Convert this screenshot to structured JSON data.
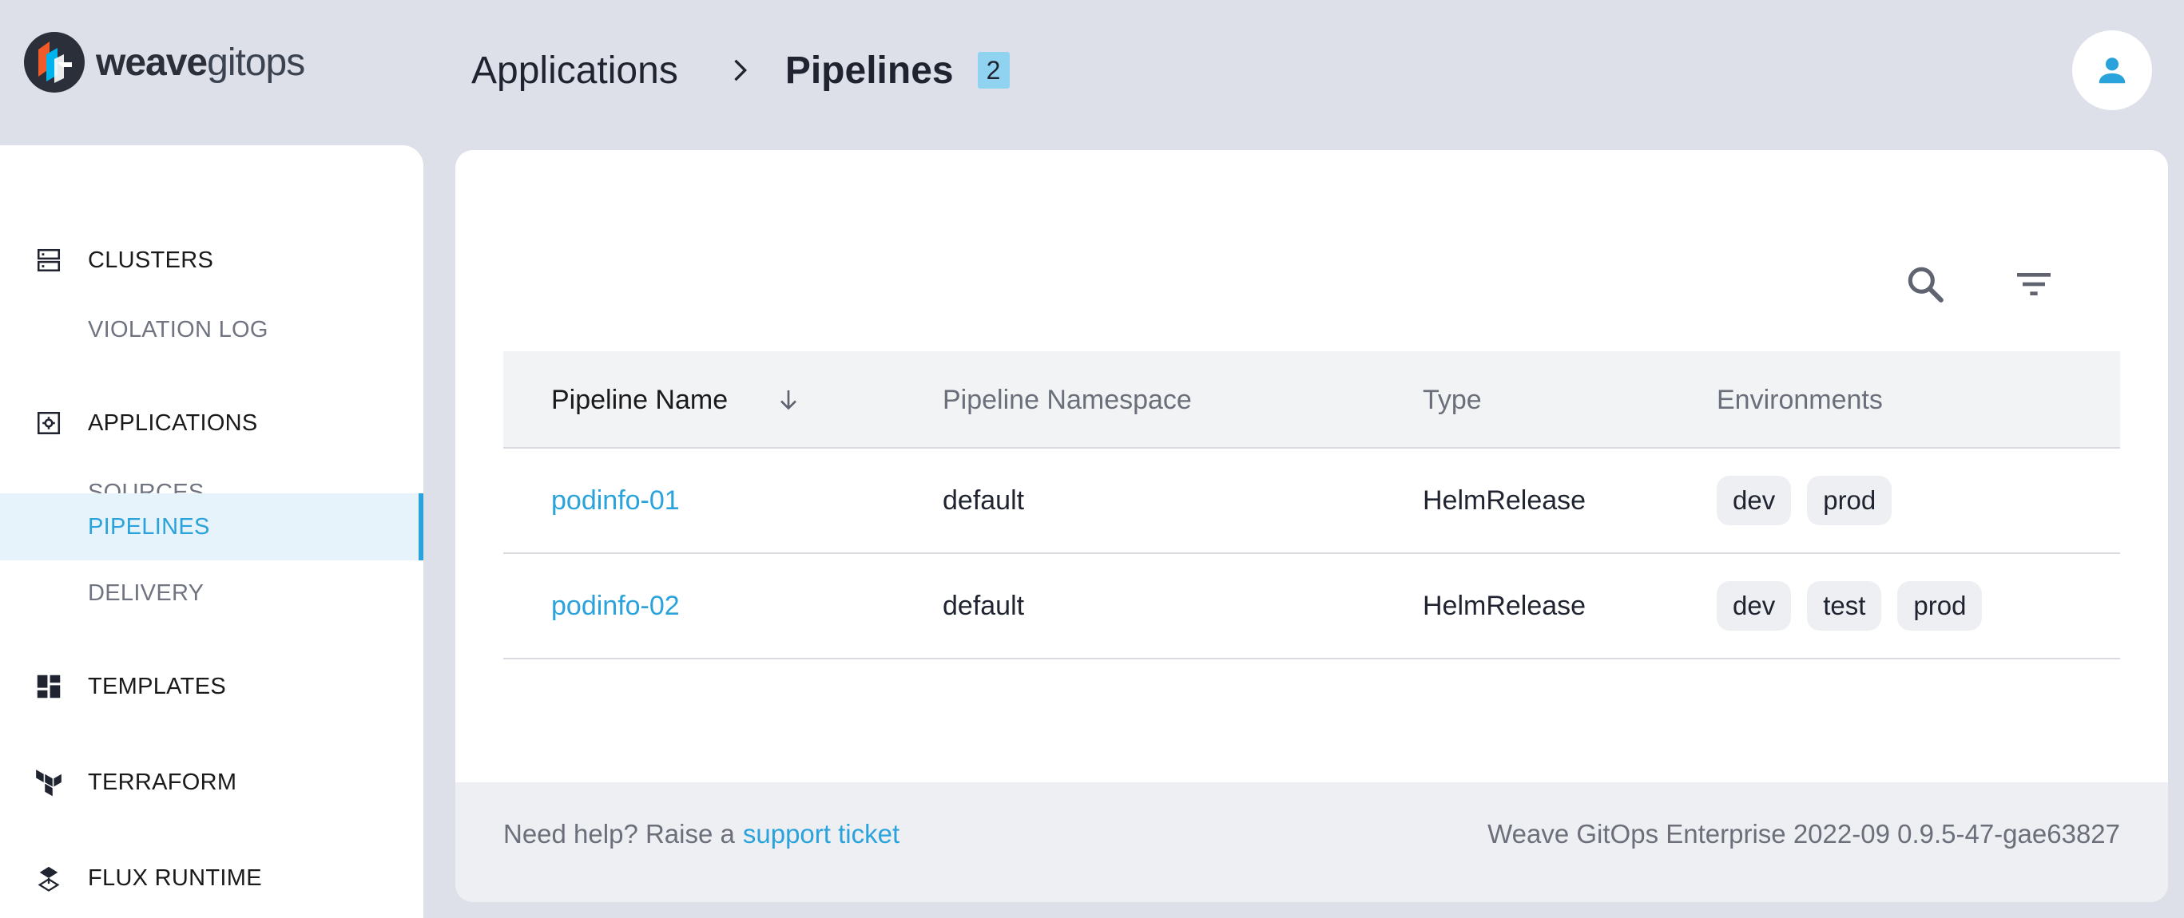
{
  "brand": {
    "name_bold": "weave",
    "name_light": "gitops"
  },
  "breadcrumb": {
    "parent": "Applications",
    "current": "Pipelines",
    "count": "2"
  },
  "sidebar": {
    "items": [
      {
        "label": "CLUSTERS",
        "icon": "server-icon",
        "level": "main"
      },
      {
        "label": "VIOLATION LOG",
        "level": "sub"
      },
      {
        "label": "APPLICATIONS",
        "icon": "app-settings-icon",
        "level": "main"
      },
      {
        "label": "SOURCES",
        "level": "sub"
      },
      {
        "label": "PIPELINES",
        "level": "sub",
        "active": true
      },
      {
        "label": "DELIVERY",
        "level": "sub"
      },
      {
        "label": "TEMPLATES",
        "icon": "dashboard-icon",
        "level": "main"
      },
      {
        "label": "TERRAFORM",
        "icon": "terraform-icon",
        "level": "main"
      },
      {
        "label": "FLUX RUNTIME",
        "icon": "flux-icon",
        "level": "main"
      }
    ]
  },
  "toolbar": {
    "search_icon": "search-icon",
    "filter_icon": "filter-icon"
  },
  "table": {
    "columns": [
      "Pipeline Name",
      "Pipeline Namespace",
      "Type",
      "Environments"
    ],
    "sort_icon": "arrow-down-icon",
    "rows": [
      {
        "name": "podinfo-01",
        "namespace": "default",
        "type": "HelmRelease",
        "environments": [
          "dev",
          "prod"
        ]
      },
      {
        "name": "podinfo-02",
        "namespace": "default",
        "type": "HelmRelease",
        "environments": [
          "dev",
          "test",
          "prod"
        ]
      }
    ]
  },
  "footer": {
    "help_text": "Need help? Raise a",
    "help_link": "support ticket",
    "version": "Weave GitOps Enterprise 2022-09 0.9.5-47-gae63827"
  },
  "colors": {
    "accent": "#2aa3dc",
    "badge": "#8fd3f0",
    "background": "#dde0e8"
  }
}
